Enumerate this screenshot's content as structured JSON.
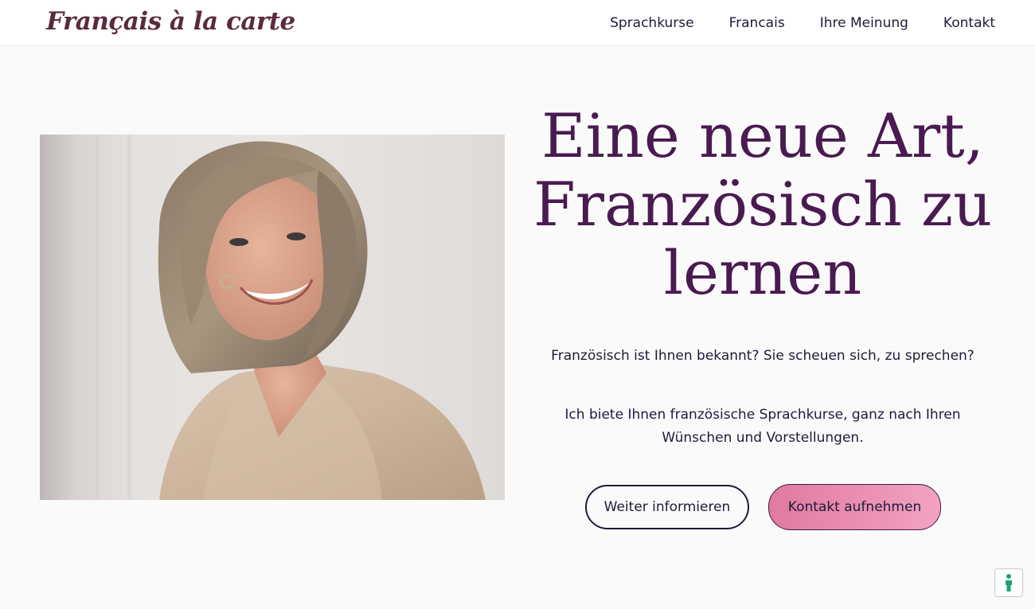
{
  "header": {
    "logo_text": "Français à la carte",
    "nav": [
      {
        "label": "Sprachkurse"
      },
      {
        "label": "Francais"
      },
      {
        "label": "Ihre Meinung"
      },
      {
        "label": "Kontakt"
      }
    ]
  },
  "hero": {
    "title": "Eine neue Art, Französisch zu lernen",
    "paragraph_1": "Französisch ist Ihnen bekannt? Sie scheuen sich, zu sprechen?",
    "paragraph_2": "Ich biete Ihnen französische Sprachkurse, ganz nach Ihren Wünschen und Vorstellungen.",
    "button_secondary": "Weiter informieren",
    "button_primary": "Kontakt aufnehmen",
    "image_icon": "portrait-photo"
  },
  "accessibility": {
    "icon": "accessibility-person-icon"
  },
  "colors": {
    "title": "#4a1a52",
    "logo": "#5a2a3e",
    "button_primary_gradient_start": "#e07aa0",
    "button_primary_gradient_end": "#f3a2c2",
    "text": "#1f1a3a",
    "accessibility_accent": "#1aa37a"
  }
}
